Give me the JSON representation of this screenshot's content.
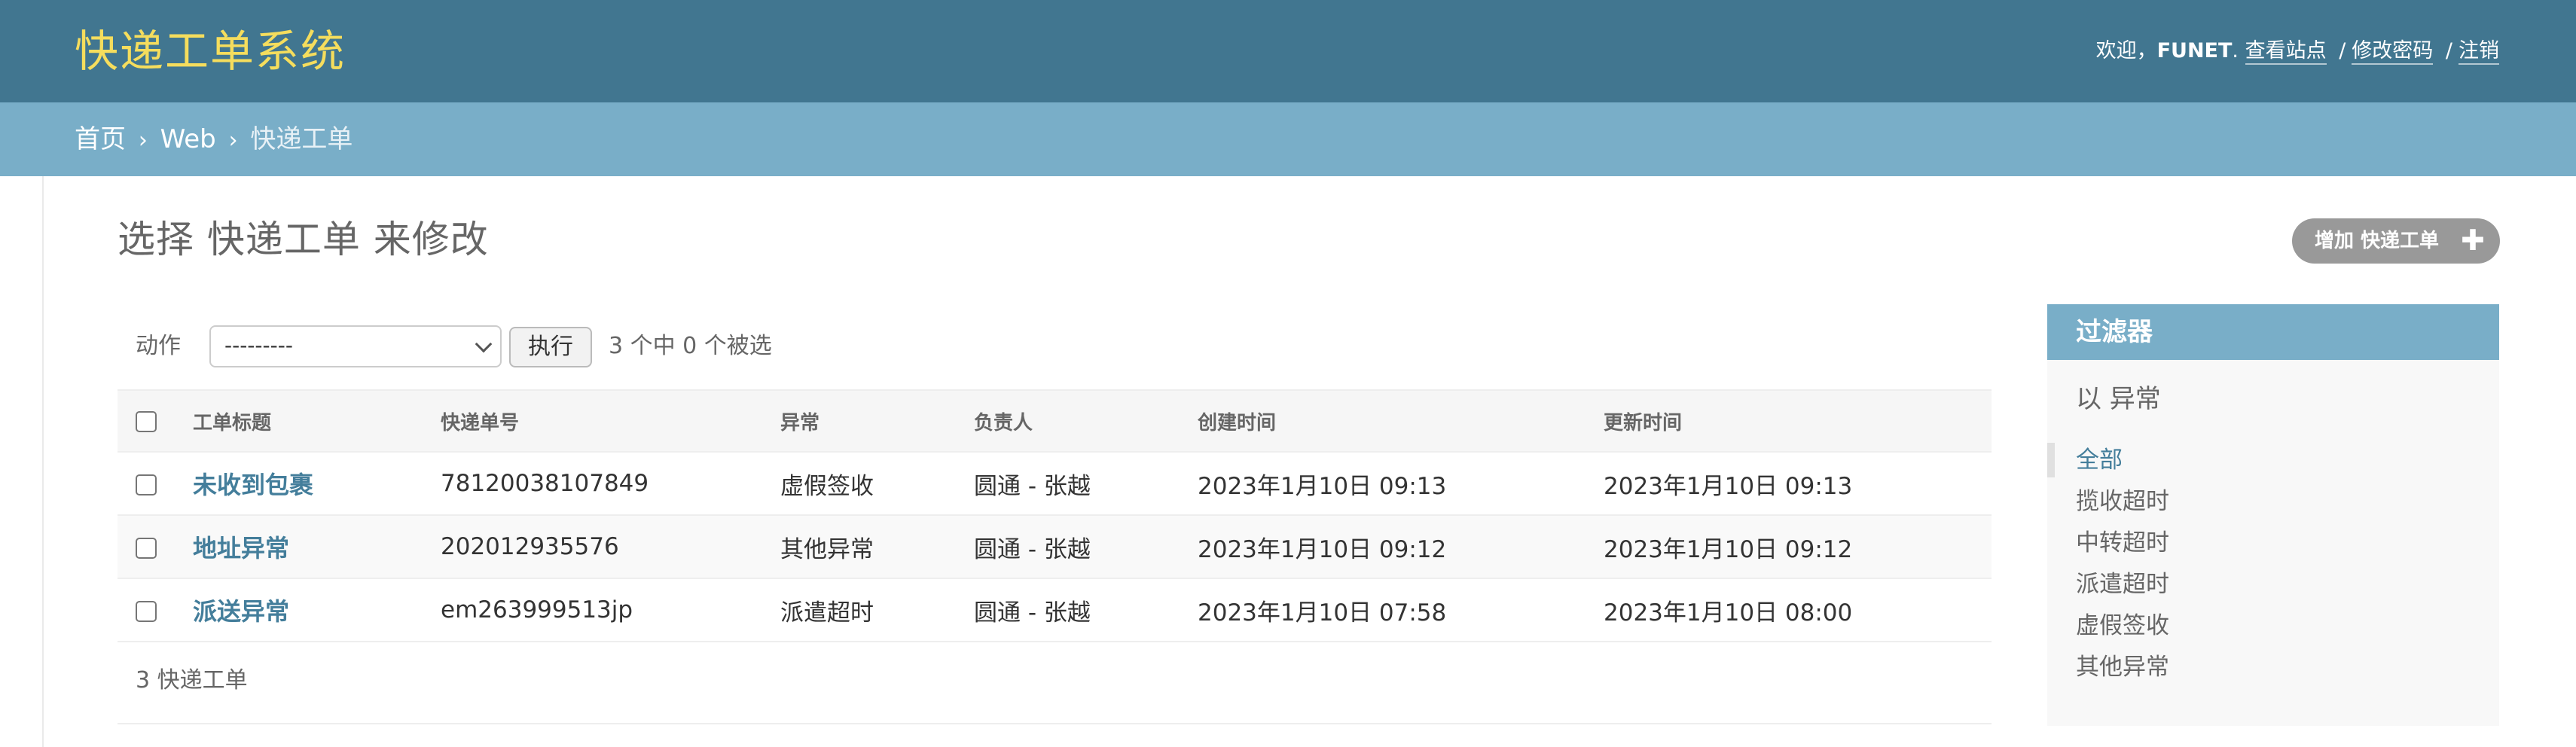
{
  "header": {
    "brand": "快递工单系统",
    "welcome": "欢迎，",
    "username": "FUNET",
    "username_suffix": ".",
    "view_site": "查看站点",
    "change_password": "修改密码",
    "logout": "注销",
    "separator": "/"
  },
  "breadcrumbs": {
    "home": "首页",
    "app": "Web",
    "current": "快递工单",
    "arrow": "›"
  },
  "page": {
    "title": "选择 快递工单 来修改",
    "add_button": "增加 快递工单",
    "add_icon": "plus-icon"
  },
  "actions": {
    "label": "动作",
    "select_value": "---------",
    "run_button": "执行",
    "counter": "3 个中 0 个被选"
  },
  "table": {
    "columns": [
      "工单标题",
      "快递单号",
      "异常",
      "负责人",
      "创建时间",
      "更新时间"
    ],
    "rows": [
      {
        "title": "未收到包裹",
        "tracking": "78120038107849",
        "anomaly": "虚假签收",
        "owner": "圆通 - 张越",
        "created": "2023年1月10日 09:13",
        "updated": "2023年1月10日 09:13"
      },
      {
        "title": "地址异常",
        "tracking": "202012935576",
        "anomaly": "其他异常",
        "owner": "圆通 - 张越",
        "created": "2023年1月10日 09:12",
        "updated": "2023年1月10日 09:12"
      },
      {
        "title": "派送异常",
        "tracking": "em263999513jp",
        "anomaly": "派遣超时",
        "owner": "圆通 - 张越",
        "created": "2023年1月10日 07:58",
        "updated": "2023年1月10日 08:00"
      }
    ],
    "result_count": "3 快递工单"
  },
  "filter": {
    "title": "过滤器",
    "by_label": "以 异常",
    "items": [
      "全部",
      "揽收超时",
      "中转超时",
      "派遣超时",
      "虚假签收",
      "其他异常"
    ],
    "selected_index": 0
  },
  "colors": {
    "header_bg": "#417690",
    "brand": "#f5dd5d",
    "breadcrumb_bg": "#79aec8",
    "link": "#447e9b",
    "add_button_bg": "#999999"
  }
}
